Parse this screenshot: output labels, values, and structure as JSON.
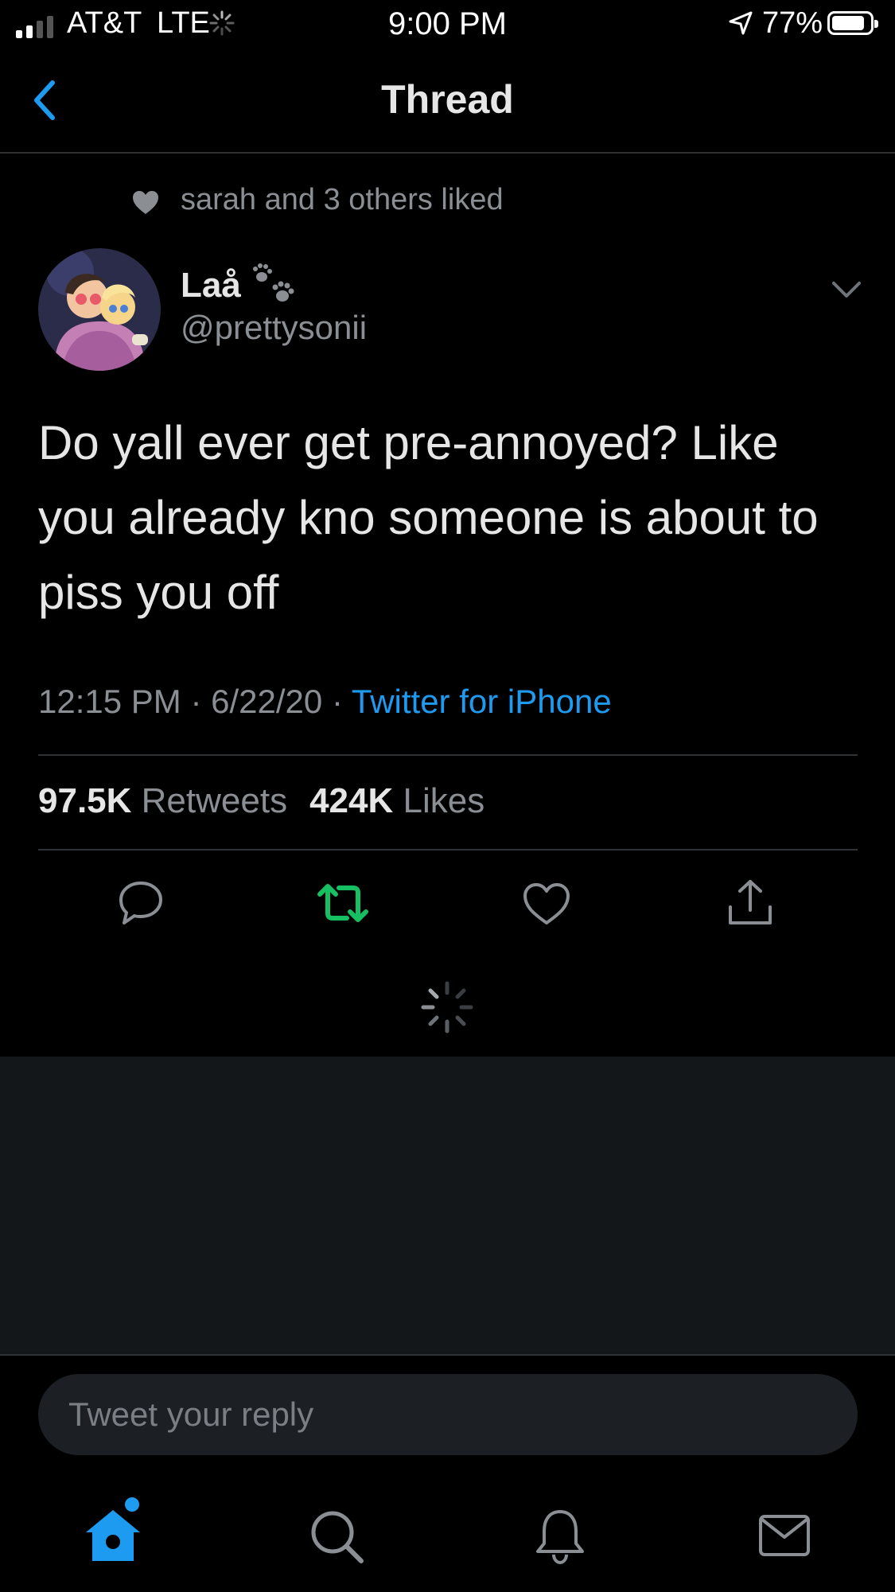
{
  "status_bar": {
    "carrier": "AT&T",
    "network": "LTE",
    "time": "9:00 PM",
    "battery": "77%"
  },
  "nav": {
    "title": "Thread",
    "back_icon": "chevron-left-icon"
  },
  "social_context": {
    "icon": "heart-icon",
    "text": "sarah and 3 others liked"
  },
  "tweet": {
    "author_name": "Laå",
    "author_handle": "@prettysonii",
    "text": "Do yall ever get pre-annoyed? Like you already kno someone is about to piss you off",
    "time": "12:15 PM",
    "date": "6/22/20",
    "separator": "·",
    "source": "Twitter for iPhone",
    "retweets_count": "97.5K",
    "retweets_label": "Retweets",
    "likes_count": "424K",
    "likes_label": "Likes",
    "retweeted": true
  },
  "actions": [
    "reply-icon",
    "retweet-icon",
    "like-icon",
    "share-icon"
  ],
  "reply_box": {
    "placeholder": "Tweet your reply"
  },
  "tab_bar": {
    "items": [
      "home-icon",
      "search-icon",
      "notifications-icon",
      "messages-icon"
    ],
    "active": "home-icon"
  },
  "colors": {
    "background": "#000000",
    "accent": "#1d9bf0",
    "retweet_green": "#17bf63",
    "secondary_text": "#8b8f94",
    "divider": "#2f3336"
  }
}
